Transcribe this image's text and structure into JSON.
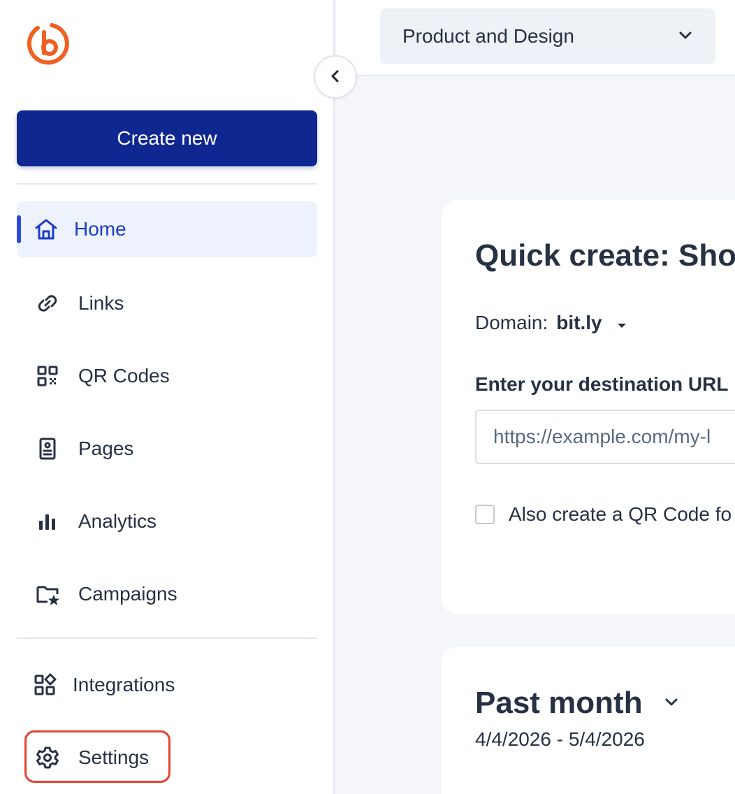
{
  "sidebar": {
    "create_label": "Create new",
    "collapse_label": "Collapse sidebar",
    "items": [
      {
        "label": "Home",
        "icon": "home-icon",
        "active": true
      },
      {
        "label": "Links",
        "icon": "link-icon"
      },
      {
        "label": "QR Codes",
        "icon": "qr-code-icon"
      },
      {
        "label": "Pages",
        "icon": "pages-icon"
      },
      {
        "label": "Analytics",
        "icon": "bar-chart-icon"
      },
      {
        "label": "Campaigns",
        "icon": "campaign-folder-icon"
      }
    ],
    "bottom_items": [
      {
        "label": "Integrations",
        "icon": "integrations-icon"
      },
      {
        "label": "Settings",
        "icon": "gear-icon",
        "highlighted": true
      }
    ]
  },
  "header": {
    "workspace_name": "Product and Design"
  },
  "quick_create": {
    "title": "Quick create: Sho",
    "domain_label": "Domain:",
    "domain_value": "bit.ly",
    "url_label": "Enter your destination URL",
    "url_placeholder": "https://example.com/my-l",
    "qr_checkbox_label": "Also create a QR Code fo"
  },
  "period": {
    "title": "Past month",
    "range": "4/4/2026 - 5/4/2026"
  },
  "colors": {
    "brand_orange": "#ee6123",
    "primary_blue": "#0f2891",
    "active_bg": "#edf2fd",
    "active_text": "#1b3cc7",
    "highlight_red": "#e5432f"
  }
}
